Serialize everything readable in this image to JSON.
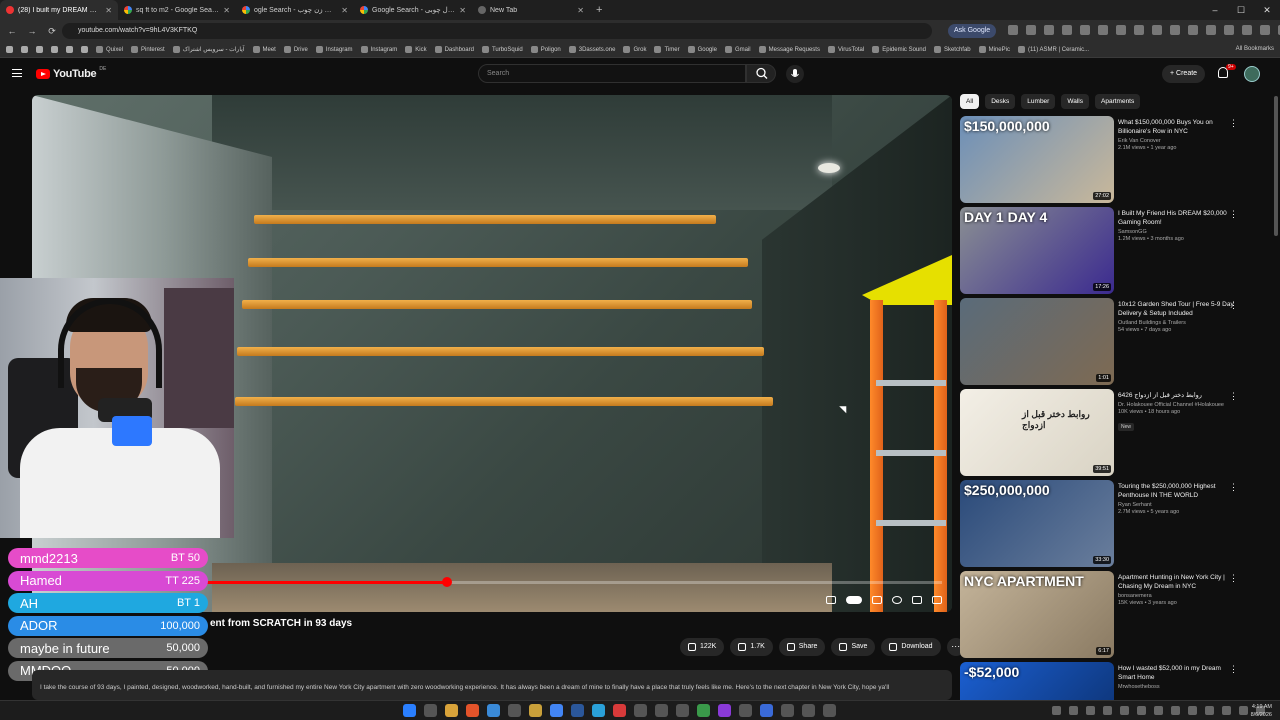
{
  "browser": {
    "tabs": [
      {
        "label": "(28) I built my DREAM New Yo",
        "active": true,
        "icon": "youtube-icon"
      },
      {
        "label": "sq ft to m2 - Google Search",
        "active": false,
        "icon": "google-icon"
      },
      {
        "label": "ogle Search - متله اریت زن چوب",
        "active": false,
        "icon": "google-icon"
      },
      {
        "label": "Google Search - کنسول چوبی",
        "active": false,
        "icon": "google-icon"
      },
      {
        "label": "New Tab",
        "active": false,
        "icon": "newtab-icon"
      }
    ],
    "url": "youtube.com/watch?v=9hL4V3KFTKQ",
    "ask_google": "Ask Google",
    "bookmarks": [
      "Quixel",
      "Pinterest",
      "آپارات - سرویس اشتراک",
      "Meet",
      "Drive",
      "Instagram",
      "Instagram",
      "Kick",
      "Dashboard",
      "TurboSquid",
      "Poligon",
      "3Dassets.one",
      "Grok",
      "Timer",
      "Google",
      "Gmail",
      "Message Requests",
      "VirusTotal",
      "Epidemic Sound",
      "Sketchfab",
      "MinePic",
      "(11) ASMR | Ceramic..."
    ],
    "all_bookmarks": "All Bookmarks"
  },
  "youtube": {
    "logo": "YouTube",
    "country": "DE",
    "search_placeholder": "Search",
    "create": "Create",
    "notifications": "9+"
  },
  "video": {
    "title_visible": "ent from SCRATCH in 93 days",
    "progress": 0.45,
    "likes": "122K",
    "dislikes": "1.7K",
    "share": "Share",
    "save": "Save",
    "download": "Download",
    "description": "I take the course of 93 days, I painted, designed, woodworked, hand-built, and furnished my entire New York City apartment with zero woodworking experience. It has always been a dream of mine to finally have a place that truly feels like me. Here's to the next chapter in New York City, hope ya'll"
  },
  "donations": [
    {
      "name": "mmd2213",
      "amount": "BT 50",
      "color": "#e64cc8"
    },
    {
      "name": "Hamed",
      "amount": "TT 225",
      "color": "#d84ad4"
    },
    {
      "name": "AH",
      "amount": "BT 1",
      "color": "#1fa8e0"
    },
    {
      "name": "ADOR",
      "amount": "100,000",
      "color": "#2a8ce6"
    },
    {
      "name": "maybe in future",
      "amount": "50,000",
      "color": "#6a6a6a"
    },
    {
      "name": "MMDOO",
      "amount": "50,000",
      "color": "#6a6a6a"
    }
  ],
  "chips": [
    "All",
    "Desks",
    "Lumber",
    "Walls",
    "Apartments"
  ],
  "recommendations": [
    {
      "title": "What $150,000,000 Buys You on Billionaire's Row in NYC",
      "channel": "Erik Van Conover",
      "meta": "2.1M views • 1 year ago",
      "duration": "27:02",
      "thumb_text": "$150,000,000",
      "colors": [
        "#6c8fb8",
        "#c9b89a"
      ]
    },
    {
      "title": "I Built My Friend His DREAM $20,000 Gaming Room!",
      "channel": "SamsonGG",
      "meta": "1.2M views • 3 months ago",
      "duration": "17:26",
      "thumb_text": "DAY 1   DAY 4",
      "colors": [
        "#8a8f93",
        "#3b2a8f"
      ]
    },
    {
      "title": "10x12 Garden Shed Tour | Free 5-9 Day Delivery & Setup Included",
      "channel": "Outland Buildings & Trailers",
      "meta": "54 views • 7 days ago",
      "duration": "1:01",
      "thumb_text": "",
      "colors": [
        "#5a6b7a",
        "#7e6a52"
      ]
    },
    {
      "title": "روابط دختر قبل از ازدواج 6426",
      "channel": "Dr. Holakouee Official Channel #Holakouee",
      "meta": "10K views • 18 hours ago",
      "duration": "39:51",
      "thumb_text": "روابط دختر قبل از ازدواج",
      "colors": [
        "#f3efe6",
        "#d9d3c4"
      ],
      "new": "New"
    },
    {
      "title": "Touring the $250,000,000 Highest Penthouse IN THE WORLD",
      "channel": "Ryan Serhant",
      "meta": "2.7M views • 5 years ago",
      "duration": "33:30",
      "thumb_text": "$250,000,000",
      "colors": [
        "#2a4a7a",
        "#6a7e9c"
      ]
    },
    {
      "title": "Apartment Hunting in New York City | Chasing My Dream in NYC",
      "channel": "bonsanemera",
      "meta": "15K views • 3 years ago",
      "duration": "6:17",
      "thumb_text": "NYC APARTMENT",
      "colors": [
        "#c4b49a",
        "#8a7a62"
      ]
    },
    {
      "title": "How I wasted $52,000 in my Dream Smart Home",
      "channel": "Mrwhosetheboss",
      "meta": "",
      "duration": "",
      "thumb_text": "-$52,000",
      "colors": [
        "#1b5fd1",
        "#0b2e6a"
      ]
    }
  ],
  "taskbar": {
    "time": "4:19 AM",
    "date": "8/6/2026"
  }
}
